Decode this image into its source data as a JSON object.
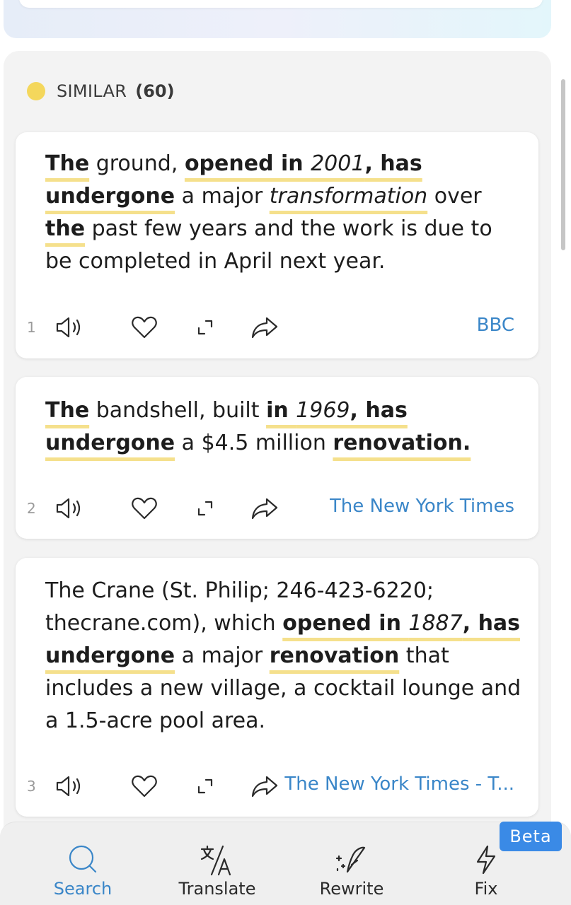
{
  "section": {
    "label": "SIMILAR",
    "count": "(60)"
  },
  "cards": [
    {
      "number": "1",
      "source": "BBC",
      "segments": [
        {
          "t": "The",
          "b": true,
          "h": true
        },
        {
          "t": " ground, "
        },
        {
          "t": "opened in ",
          "b": true,
          "h": true
        },
        {
          "t": "2001",
          "i": true,
          "h": true
        },
        {
          "t": ", has",
          "b": true,
          "h": true
        },
        {
          "t": " "
        },
        {
          "t": "undergone",
          "b": true,
          "h": true
        },
        {
          "t": " a major "
        },
        {
          "t": "transformation",
          "i": true,
          "h": true
        },
        {
          "t": " over "
        },
        {
          "t": "the",
          "b": true,
          "h": true
        },
        {
          "t": " past few years and the work is due to be completed in April next year."
        }
      ]
    },
    {
      "number": "2",
      "source": "The New York Times",
      "segments": [
        {
          "t": "The",
          "b": true,
          "h": true
        },
        {
          "t": " bandshell, built "
        },
        {
          "t": "in ",
          "b": true,
          "h": true
        },
        {
          "t": "1969",
          "i": true,
          "h": true
        },
        {
          "t": ", has",
          "b": true,
          "h": true
        },
        {
          "t": " "
        },
        {
          "t": "undergone",
          "b": true,
          "h": true
        },
        {
          "t": " a $4.5 million "
        },
        {
          "t": "renovation.",
          "b": true,
          "h": true
        }
      ]
    },
    {
      "number": "3",
      "source": "The New York Times - T...",
      "segments": [
        {
          "t": "The Crane (St. Philip; 246-423-6220; thecrane.com), which "
        },
        {
          "t": "opened in ",
          "b": true,
          "h": true
        },
        {
          "t": "1887",
          "i": true,
          "h": true
        },
        {
          "t": ", has",
          "b": true,
          "h": true
        },
        {
          "t": " "
        },
        {
          "t": "undergone",
          "b": true,
          "h": true
        },
        {
          "t": " a major "
        },
        {
          "t": "renovation",
          "b": true,
          "h": true
        },
        {
          "t": " that includes a new village, a cocktail lounge and a 1.5-acre pool area."
        }
      ]
    }
  ],
  "nav": {
    "search": "Search",
    "translate": "Translate",
    "rewrite": "Rewrite",
    "fix": "Fix",
    "beta": "Beta"
  },
  "colors": {
    "accent": "#3a86c8",
    "highlight": "#f5e08c",
    "dot": "#f4d75c",
    "beta": "#3a8ae6"
  }
}
